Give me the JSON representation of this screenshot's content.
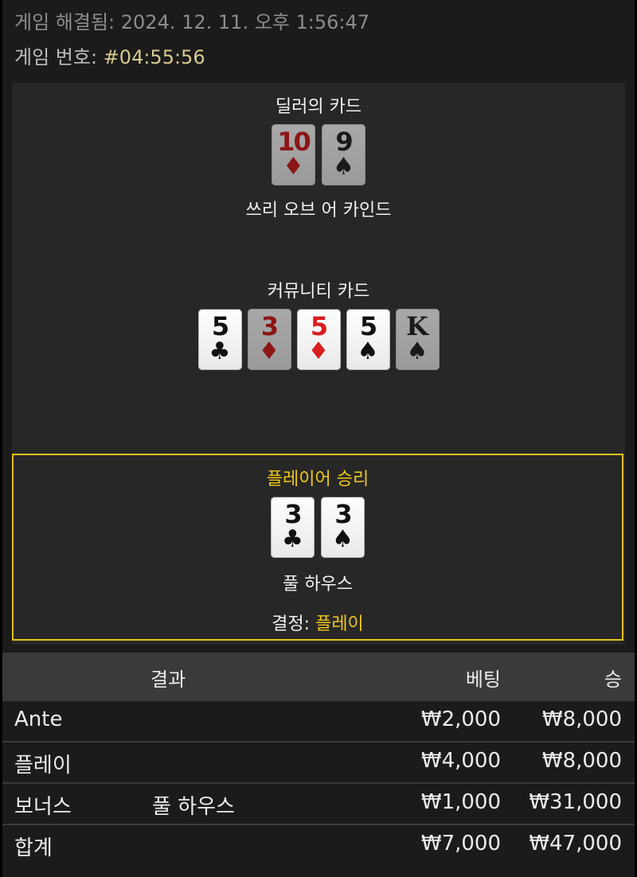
{
  "header": {
    "resolved_label": "게임 해결됨:",
    "resolved_value": "2024. 12. 11. 오후 1:56:47",
    "game_number_label": "게임 번호:",
    "game_number_value": "#04:55:56"
  },
  "dealer": {
    "title": "딜러의 카드",
    "cards": [
      {
        "rank": "10",
        "suit": "♦",
        "color": "red",
        "dim": true
      },
      {
        "rank": "9",
        "suit": "♠",
        "color": "black",
        "dim": true
      }
    ],
    "hand": "쓰리 오브 어 카인드"
  },
  "community": {
    "title": "커뮤니티 카드",
    "cards": [
      {
        "rank": "5",
        "suit": "♣",
        "color": "black",
        "dim": false
      },
      {
        "rank": "3",
        "suit": "♦",
        "color": "red",
        "dim": true
      },
      {
        "rank": "5",
        "suit": "♦",
        "color": "red",
        "dim": false
      },
      {
        "rank": "5",
        "suit": "♠",
        "color": "black",
        "dim": false
      },
      {
        "rank": "K",
        "suit": "♠",
        "color": "black",
        "dim": true
      }
    ]
  },
  "player": {
    "title": "플레이어 승리",
    "cards": [
      {
        "rank": "3",
        "suit": "♣",
        "color": "black",
        "dim": false
      },
      {
        "rank": "3",
        "suit": "♠",
        "color": "black",
        "dim": false
      }
    ],
    "hand": "풀 하우스",
    "decision_label": "결정:",
    "decision_value": "플레이",
    "accent_color": "#f0c81a"
  },
  "results": {
    "headers": {
      "result": "결과",
      "bet": "베팅",
      "win": "승"
    },
    "rows": [
      {
        "label": "Ante",
        "desc": "",
        "bet": "₩2,000",
        "win": "₩8,000"
      },
      {
        "label": "플레이",
        "desc": "",
        "bet": "₩4,000",
        "win": "₩8,000"
      },
      {
        "label": "보너스",
        "desc": "풀 하우스",
        "bet": "₩1,000",
        "win": "₩31,000"
      },
      {
        "label": "합계",
        "desc": "",
        "bet": "₩7,000",
        "win": "₩47,000"
      }
    ]
  }
}
